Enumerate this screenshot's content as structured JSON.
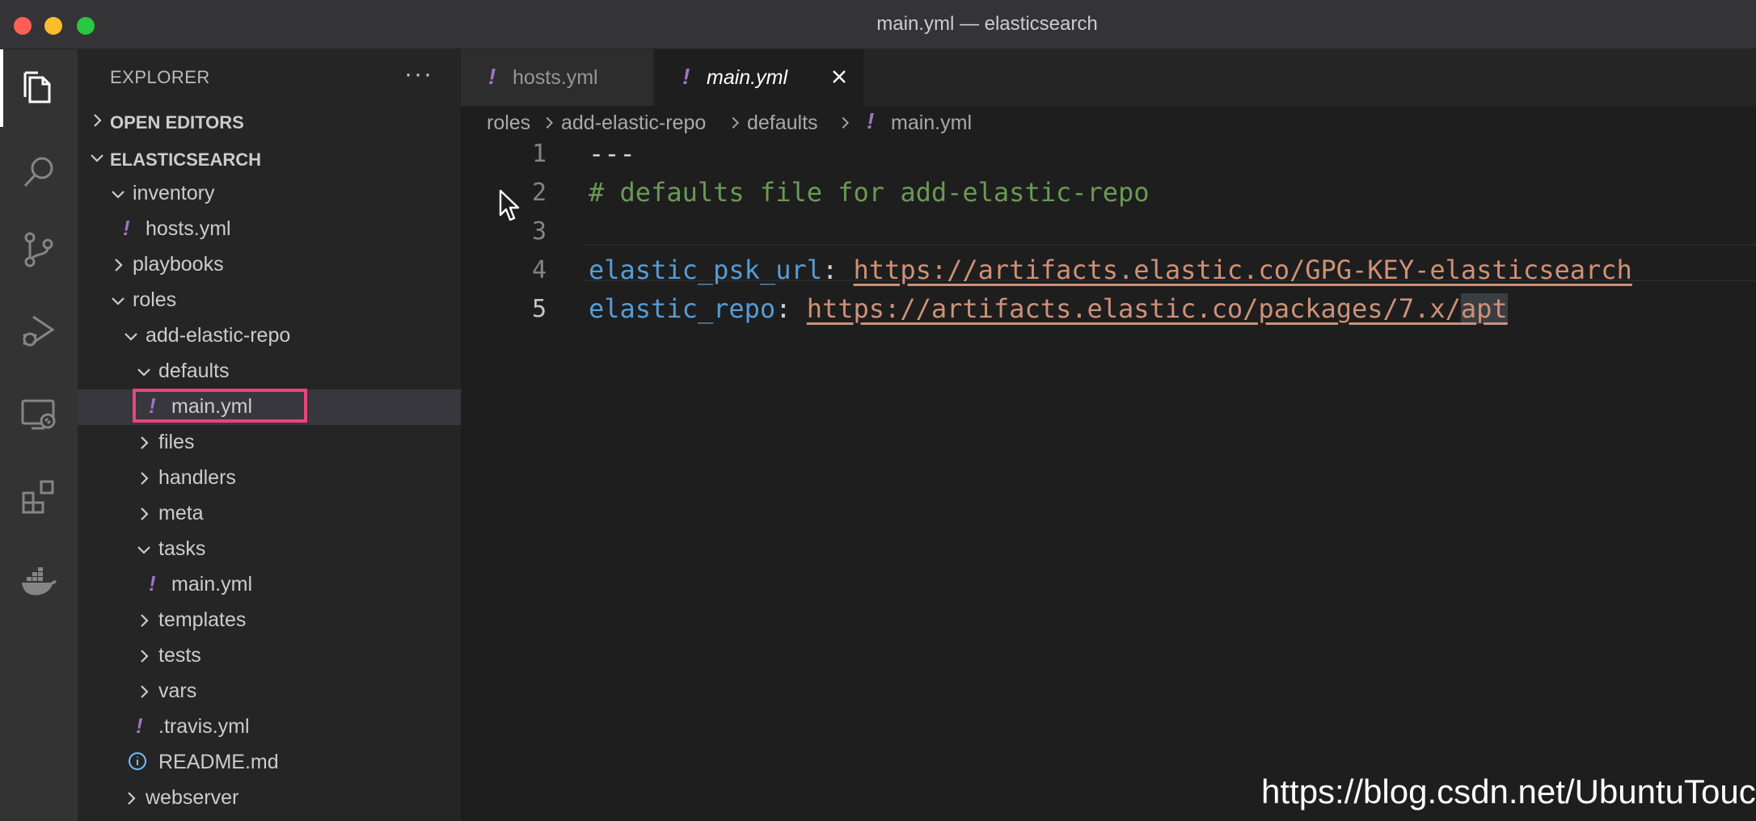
{
  "window": {
    "title": "main.yml — elasticsearch"
  },
  "activity_bar": {
    "items": [
      "files-icon",
      "search-icon",
      "source-control-icon",
      "run-debug-icon",
      "remote-explorer-icon",
      "extensions-icon",
      "docker-icon"
    ],
    "active": "files-icon"
  },
  "sidebar": {
    "title": "EXPLORER",
    "more": "···",
    "open_editors": "OPEN EDITORS",
    "project": "ELASTICSEARCH",
    "tree": [
      {
        "label": "inventory",
        "type": "folder-open"
      },
      {
        "label": "hosts.yml",
        "type": "yaml"
      },
      {
        "label": "playbooks",
        "type": "folder-closed"
      },
      {
        "label": "roles",
        "type": "folder-open"
      },
      {
        "label": "add-elastic-repo",
        "type": "folder-open"
      },
      {
        "label": "defaults",
        "type": "folder-open"
      },
      {
        "label": "main.yml",
        "type": "yaml",
        "selected": true
      },
      {
        "label": "files",
        "type": "folder-closed"
      },
      {
        "label": "handlers",
        "type": "folder-closed"
      },
      {
        "label": "meta",
        "type": "folder-closed"
      },
      {
        "label": "tasks",
        "type": "folder-open"
      },
      {
        "label": "main.yml",
        "type": "yaml"
      },
      {
        "label": "templates",
        "type": "folder-closed"
      },
      {
        "label": "tests",
        "type": "folder-closed"
      },
      {
        "label": "vars",
        "type": "folder-closed"
      },
      {
        "label": ".travis.yml",
        "type": "yaml"
      },
      {
        "label": "README.md",
        "type": "info"
      },
      {
        "label": "webserver",
        "type": "folder-closed"
      }
    ]
  },
  "tabs": [
    {
      "label": "hosts.yml",
      "icon": "!",
      "active": false
    },
    {
      "label": "main.yml",
      "icon": "!",
      "active": true
    }
  ],
  "breadcrumb": [
    "roles",
    "add-elastic-repo",
    "defaults",
    "main.yml"
  ],
  "breadcrumb_icon": "!",
  "editor": {
    "lines": [
      {
        "number": "1",
        "dashes": "---"
      },
      {
        "number": "2",
        "comment": "# defaults file for add-elastic-repo"
      },
      {
        "number": "3"
      },
      {
        "number": "4",
        "key": "elastic_psk_url",
        "colon": ":",
        "value": "https://artifacts.elastic.co/GPG-KEY-elasticsearch"
      },
      {
        "number": "5",
        "key": "elastic_repo",
        "colon": ":",
        "value_a": "https://artifacts.elastic.co/packages/7.x/",
        "value_b": "apt"
      }
    ],
    "active_line": "5"
  },
  "watermark": "https://blog.csdn.net/UbuntuTouch",
  "colors": {
    "accent_highlight": "#e8457a",
    "yaml_icon": "#a074c4",
    "comment": "#6a9955",
    "key": "#569cd6",
    "string": "#ce9178"
  }
}
